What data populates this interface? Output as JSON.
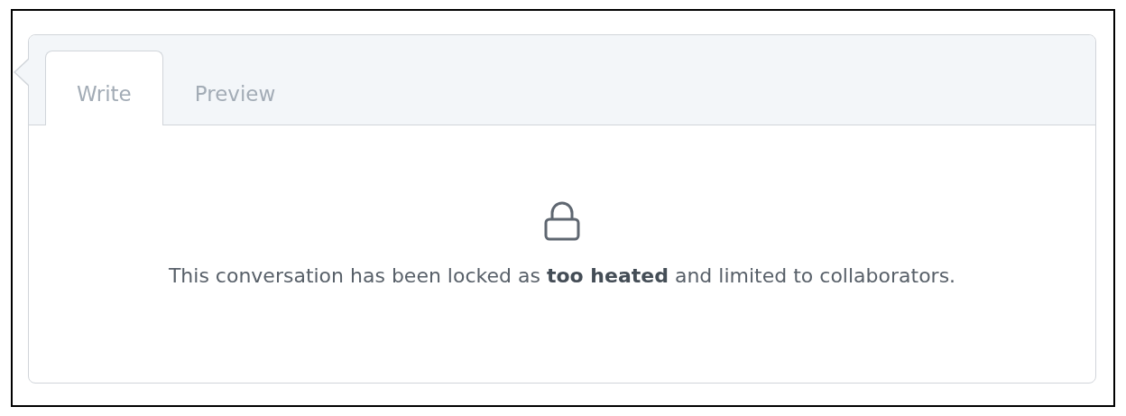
{
  "tabs": [
    {
      "label": "Write",
      "selected": true
    },
    {
      "label": "Preview",
      "selected": false
    }
  ],
  "message": "This conversation has been locked as **too heated** and limited to collaborators."
}
